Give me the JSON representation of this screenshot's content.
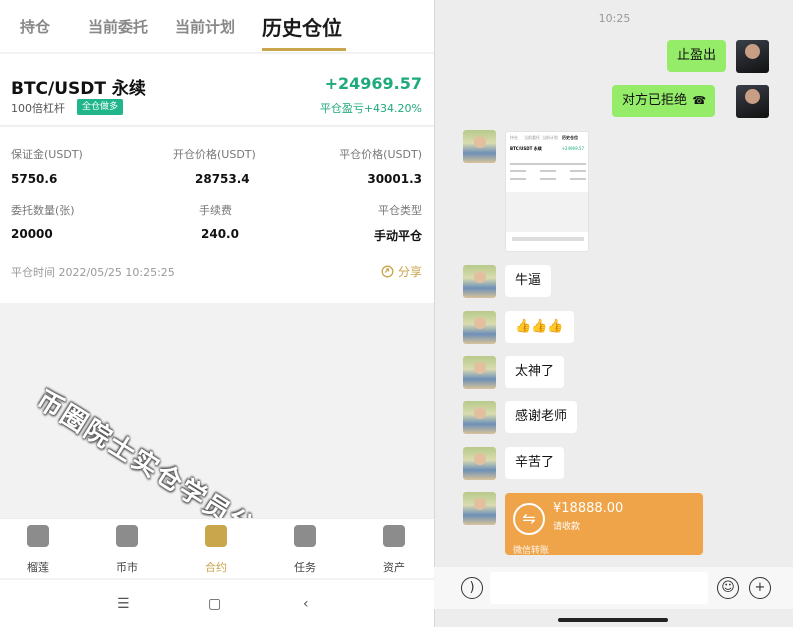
{
  "trade": {
    "tabs": [
      "持仓",
      "当前委托",
      "当前计划",
      "历史仓位"
    ],
    "pair": "BTC/USDT 永续",
    "leverage": "100倍杠杆",
    "mode_badge": "全仓做多",
    "pnl": "+24969.57",
    "pnl_ratio": "平仓盈亏+434.20%",
    "fields": {
      "margin_label": "保证金(USDT)",
      "margin_value": "5750.6",
      "open_label": "开仓价格(USDT)",
      "open_value": "28753.4",
      "close_label": "平仓价格(USDT)",
      "close_value": "30001.3",
      "qty_label": "委托数量(张)",
      "qty_value": "20000",
      "fee_label": "手续费",
      "fee_value": "240.0",
      "type_label": "平仓类型",
      "type_value": "手动平仓"
    },
    "close_time": "平仓时间 2022/05/25 10:25:25",
    "share": "分享",
    "watermark": "币圈院士实仓学员分享",
    "nav": [
      "榴莲",
      "币市",
      "合约",
      "任务",
      "资产"
    ],
    "accent_color": "#c9a54c",
    "profit_color": "#1faa7d"
  },
  "chat": {
    "time": "10:25",
    "messages": [
      {
        "from": "me",
        "text": "止盈出"
      },
      {
        "from": "me",
        "text": "对方已拒绝"
      },
      {
        "from": "other",
        "type": "image"
      },
      {
        "from": "other",
        "text": "牛逼"
      },
      {
        "from": "other",
        "text": "👍👍👍"
      },
      {
        "from": "other",
        "text": "太神了"
      },
      {
        "from": "other",
        "text": "感谢老师"
      },
      {
        "from": "other",
        "text": "辛苦了"
      }
    ],
    "transfer": {
      "amount": "¥18888.00",
      "note": "请收款",
      "label": "微信转账"
    },
    "thumb": {
      "tab": "历史仓位",
      "pair": "BTC/USDT 永续",
      "pnl": "+24969.57"
    }
  }
}
